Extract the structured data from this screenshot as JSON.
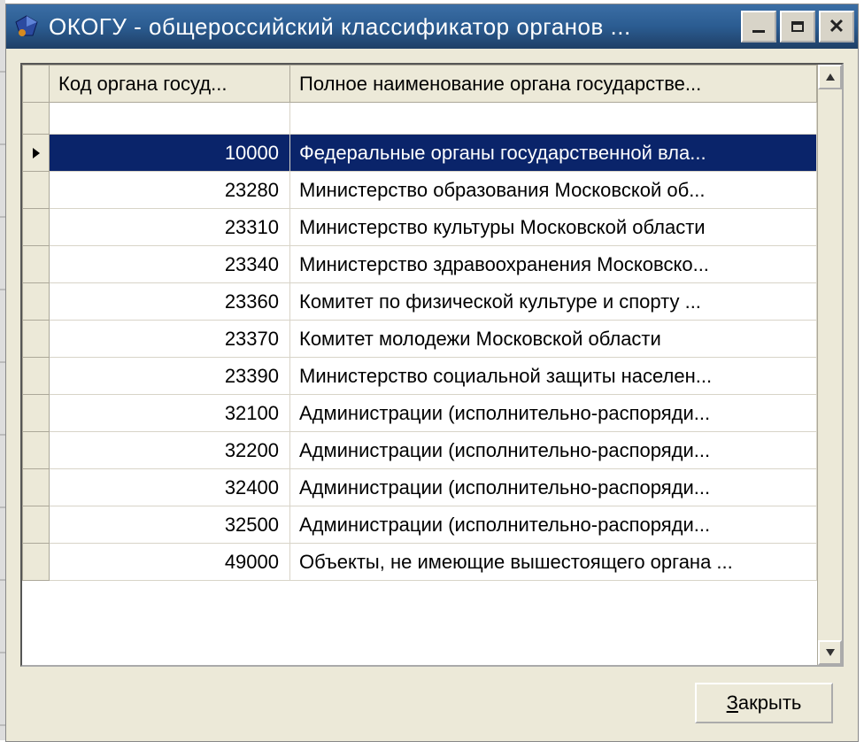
{
  "window": {
    "title": "ОКОГУ - общероссийский классификатор органов ..."
  },
  "grid": {
    "headers": {
      "code": "Код органа госуд...",
      "name": "Полное наименование органа государстве..."
    },
    "rows": [
      {
        "code": "10000",
        "name": "Федеральные органы государственной вла...",
        "selected": true
      },
      {
        "code": "23280",
        "name": "Министерство образования Московской об...",
        "selected": false
      },
      {
        "code": "23310",
        "name": "Министерство культуры Московской области",
        "selected": false
      },
      {
        "code": "23340",
        "name": "Министерство здравоохранения Московско...",
        "selected": false
      },
      {
        "code": "23360",
        "name": "Комитет по физической культуре и спорту ...",
        "selected": false
      },
      {
        "code": "23370",
        "name": "Комитет молодежи Московской области",
        "selected": false
      },
      {
        "code": "23390",
        "name": "Министерство социальной защиты населен...",
        "selected": false
      },
      {
        "code": "32100",
        "name": "Администрации (исполнительно-распоряди...",
        "selected": false
      },
      {
        "code": "32200",
        "name": "Администрации (исполнительно-распоряди...",
        "selected": false
      },
      {
        "code": "32400",
        "name": "Администрации (исполнительно-распоряди...",
        "selected": false
      },
      {
        "code": "32500",
        "name": "Администрации (исполнительно-распоряди...",
        "selected": false
      },
      {
        "code": "49000",
        "name": "Объекты, не имеющие вышестоящего органа ...",
        "selected": false
      }
    ]
  },
  "buttons": {
    "close_prefix": "З",
    "close_rest": "акрыть"
  }
}
